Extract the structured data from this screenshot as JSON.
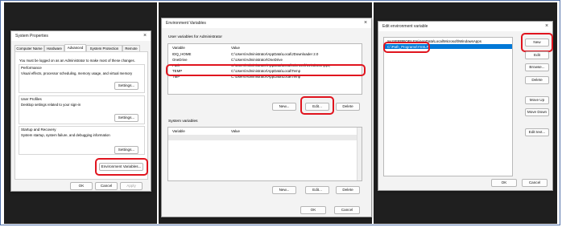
{
  "sysprops": {
    "title": "System Properties",
    "tabs": [
      "Computer Name",
      "Hardware",
      "Advanced",
      "System Protection",
      "Remote"
    ],
    "admin_note": "You must be logged on as an Administrator to make most of these changes.",
    "performance": {
      "title": "Performance",
      "desc": "Visual effects, processor scheduling, memory usage, and virtual memory",
      "button": "Settings..."
    },
    "user_profiles": {
      "title": "User Profiles",
      "desc": "Desktop settings related to your sign-in",
      "button": "Settings..."
    },
    "startup": {
      "title": "Startup and Recovery",
      "desc": "System startup, system failure, and debugging information",
      "button": "Settings..."
    },
    "env_button": "Environment Variables...",
    "ok": "OK",
    "cancel": "Cancel",
    "apply": "Apply"
  },
  "envvars": {
    "title": "Environment Variables",
    "user_section": "User variables for Administrator",
    "col_variable": "Variable",
    "col_value": "Value",
    "user_vars": [
      {
        "name": "IDQ_HOME",
        "value": "C:\\Users\\Administrator\\AppData\\Local\\JDownloader 2.0"
      },
      {
        "name": "OneDrive",
        "value": "C:\\Users\\Administrator\\OneDrive"
      },
      {
        "name": "Path",
        "value": "C:\\Users\\Administrator\\AppData\\Local\\Microsoft\\WindowsApps;"
      },
      {
        "name": "TEMP",
        "value": "C:\\Users\\Administrator\\AppData\\Local\\Temp"
      },
      {
        "name": "TMP",
        "value": "C:\\Users\\Administrator\\AppData\\Local\\Temp"
      }
    ],
    "user_buttons": {
      "new": "New...",
      "edit": "Edit...",
      "delete": "Delete"
    },
    "system_section": "System variables",
    "system_buttons": {
      "new": "New...",
      "edit": "Edit...",
      "delete": "Delete"
    },
    "ok": "OK",
    "cancel": "Cancel"
  },
  "editenv": {
    "title": "Edit environment variable",
    "entries": [
      "%USERPROFILE%\\AppData\\Local\\Microsoft\\WindowsApps",
      "C:\\Path_Programs\\YSSLF"
    ],
    "buttons": [
      "New",
      "Edit",
      "Browse...",
      "Delete",
      "Move Up",
      "Move Down",
      "Edit text..."
    ],
    "ok": "OK",
    "cancel": "Cancel"
  },
  "colors": {
    "highlight": "#e0141e",
    "selection": "#0078d7",
    "background": "#1f1f1f"
  }
}
